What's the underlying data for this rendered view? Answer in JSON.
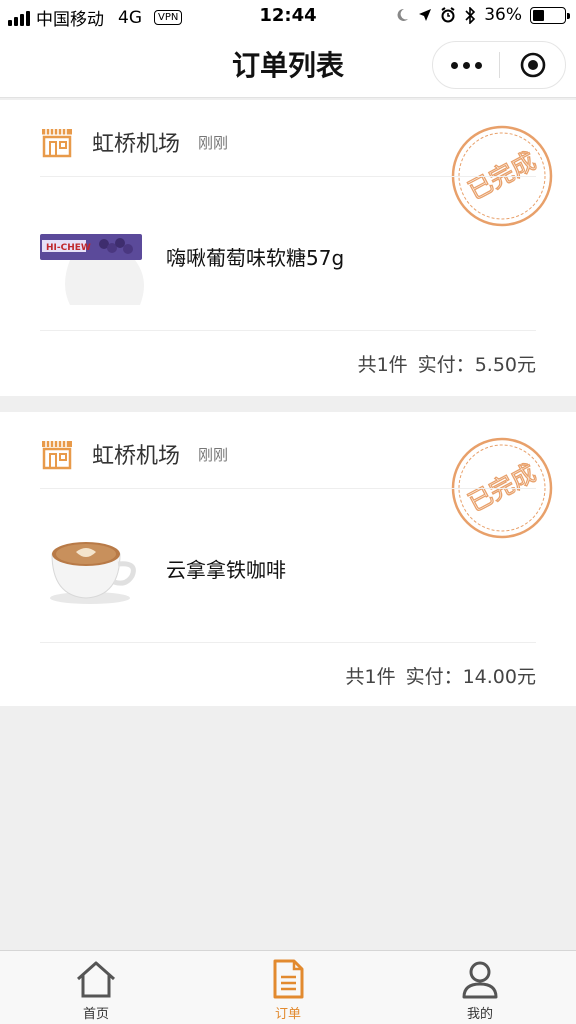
{
  "status_bar": {
    "carrier": "中国移动",
    "network": "4G",
    "vpn": "VPN",
    "time": "12:44",
    "battery": "36%",
    "battery_level": 0.36
  },
  "nav": {
    "title": "订单列表",
    "icons": [
      "more-icon",
      "target-icon"
    ]
  },
  "orders": [
    {
      "store": "虹桥机场",
      "time": "刚刚",
      "stamp": "已完成",
      "product_name": "嗨啾葡萄味软糖57g",
      "product_image": "grape-candy-image",
      "count": "共1件",
      "paid_label": "实付：",
      "paid_amount": "5.50元"
    },
    {
      "store": "虹桥机场",
      "time": "刚刚",
      "stamp": "已完成",
      "product_name": "云拿拿铁咖啡",
      "product_image": "latte-coffee-image",
      "count": "共1件",
      "paid_label": "实付：",
      "paid_amount": "14.00元"
    }
  ],
  "tabs": [
    {
      "label": "首页",
      "icon": "home-icon",
      "active": false
    },
    {
      "label": "订单",
      "icon": "order-icon",
      "active": true
    },
    {
      "label": "我的",
      "icon": "profile-icon",
      "active": false
    }
  ],
  "colors": {
    "accent": "#e28a2f",
    "stamp": "#e8a06a",
    "background": "#efefef"
  }
}
